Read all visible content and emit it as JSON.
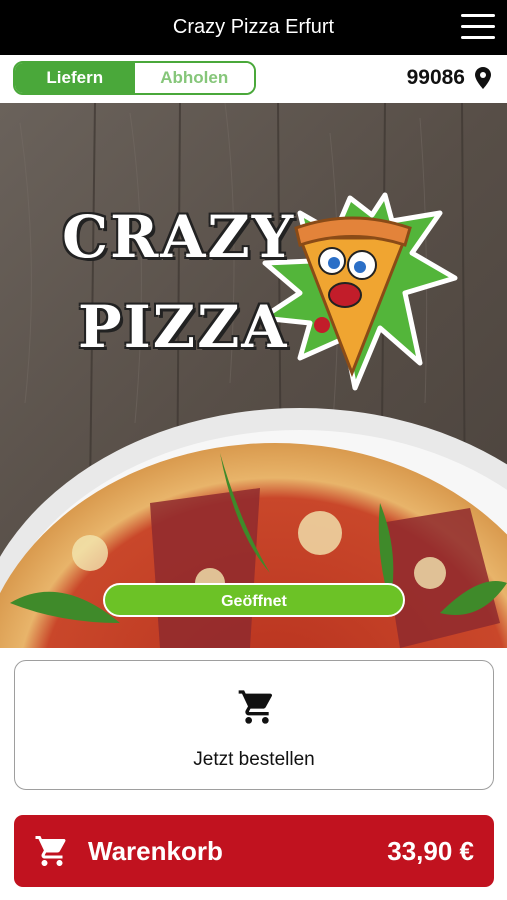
{
  "header": {
    "title": "Crazy Pizza Erfurt",
    "menu_icon": "hamburger-menu-icon"
  },
  "delivery_toggle": {
    "options": [
      "Liefern",
      "Abholen"
    ],
    "selected": "Liefern",
    "accent_color": "#4aa83a"
  },
  "location": {
    "zip": "99086",
    "icon": "location-pin-icon"
  },
  "hero": {
    "logo_lines": [
      "CRAZY",
      "PIZZA"
    ],
    "status_badge": "Geöffnet",
    "status_color": "#6cc226"
  },
  "order_card": {
    "label": "Jetzt bestellen",
    "icon": "cart-icon"
  },
  "cart_bar": {
    "label": "Warenkorb",
    "total": "33,90 €",
    "icon": "cart-icon",
    "color": "#c1121f"
  }
}
